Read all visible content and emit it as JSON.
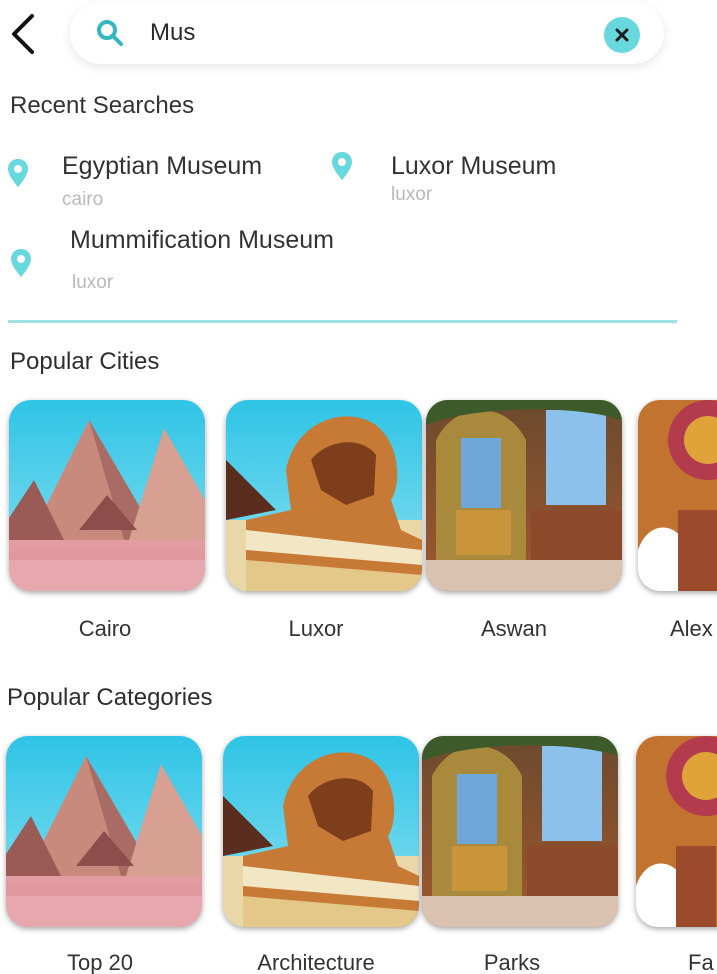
{
  "search": {
    "query": "Mus",
    "back_icon": "chevron-left-icon",
    "search_icon": "search-icon",
    "clear_icon": "close-icon"
  },
  "recent": {
    "title": "Recent Searches",
    "items": [
      {
        "name": "Egyptian Museum",
        "city": "cairo"
      },
      {
        "name": "Luxor Museum",
        "city": "luxor"
      },
      {
        "name": "Mummification Museum",
        "city": "luxor"
      }
    ]
  },
  "popular_cities": {
    "title": "Popular Cities",
    "items": [
      {
        "label": "Cairo",
        "image": "pyramids"
      },
      {
        "label": "Luxor",
        "image": "sphinx"
      },
      {
        "label": "Aswan",
        "image": "church-interior"
      },
      {
        "label": "Alex",
        "image": "mosaic-arches"
      }
    ]
  },
  "popular_categories": {
    "title": "Popular Categories",
    "items": [
      {
        "label": "Top 20",
        "image": "pyramids"
      },
      {
        "label": "Architecture",
        "image": "sphinx"
      },
      {
        "label": "Parks",
        "image": "church-interior"
      },
      {
        "label": "Fa",
        "image": "mosaic-arches"
      }
    ]
  },
  "colors": {
    "accent": "#67d9de",
    "divider": "#9ee2e6",
    "subtext": "#b9b9b9"
  }
}
